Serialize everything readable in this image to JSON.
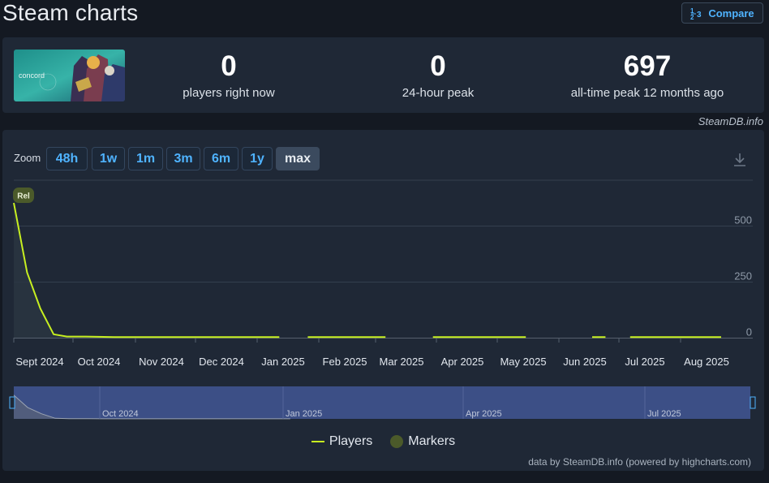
{
  "page": {
    "title": "Steam charts",
    "compare_label": "Compare"
  },
  "stats": [
    {
      "value": "0",
      "label": "players right now"
    },
    {
      "value": "0",
      "label": "24-hour peak"
    },
    {
      "value": "697",
      "label": "all-time peak 12 months ago"
    }
  ],
  "game": {
    "logo_text": "concord"
  },
  "credit_top": "SteamDB.info",
  "zoom": {
    "label": "Zoom",
    "buttons": [
      "48h",
      "1w",
      "1m",
      "3m",
      "6m",
      "1y",
      "max"
    ],
    "active": "max"
  },
  "marker": {
    "label": "Rel"
  },
  "legend": {
    "players": "Players",
    "markers": "Markers"
  },
  "credit_bottom": "data by SteamDB.info (powered by highcharts.com)",
  "colors": {
    "series": "#c7ef20",
    "accent": "#4fb3ff",
    "navigator_bg": "#3c4f86"
  },
  "chart_data": {
    "type": "line",
    "ylim": [
      0,
      697
    ],
    "y_ticks": [
      0,
      250,
      500
    ],
    "x_ticks": [
      "Sept 2024",
      "Oct 2024",
      "Nov 2024",
      "Dec 2024",
      "Jan 2025",
      "Feb 2025",
      "Mar 2025",
      "Apr 2025",
      "May 2025",
      "Jun 2025",
      "Jul 2025",
      "Aug 2025"
    ],
    "grid": true,
    "navigator_ticks": [
      "Oct 2024",
      "Jan 2025",
      "Apr 2025",
      "Jul 2025"
    ],
    "series": [
      {
        "name": "Players",
        "segments": [
          [
            [
              "2024-08-23",
              600
            ],
            [
              "2024-08-30",
              290
            ],
            [
              "2024-09-06",
              130
            ],
            [
              "2024-09-13",
              15
            ],
            [
              "2024-09-20",
              5
            ],
            [
              "2024-09-30",
              5
            ],
            [
              "2024-10-15",
              3
            ],
            [
              "2025-01-10",
              3
            ]
          ],
          [
            [
              "2025-01-25",
              3
            ],
            [
              "2025-03-07",
              3
            ]
          ],
          [
            [
              "2025-04-01",
              3
            ],
            [
              "2025-05-20",
              3
            ]
          ],
          [
            [
              "2025-06-24",
              3
            ],
            [
              "2025-07-01",
              3
            ]
          ],
          [
            [
              "2025-07-14",
              3
            ],
            [
              "2025-08-31",
              3
            ]
          ]
        ]
      }
    ]
  }
}
